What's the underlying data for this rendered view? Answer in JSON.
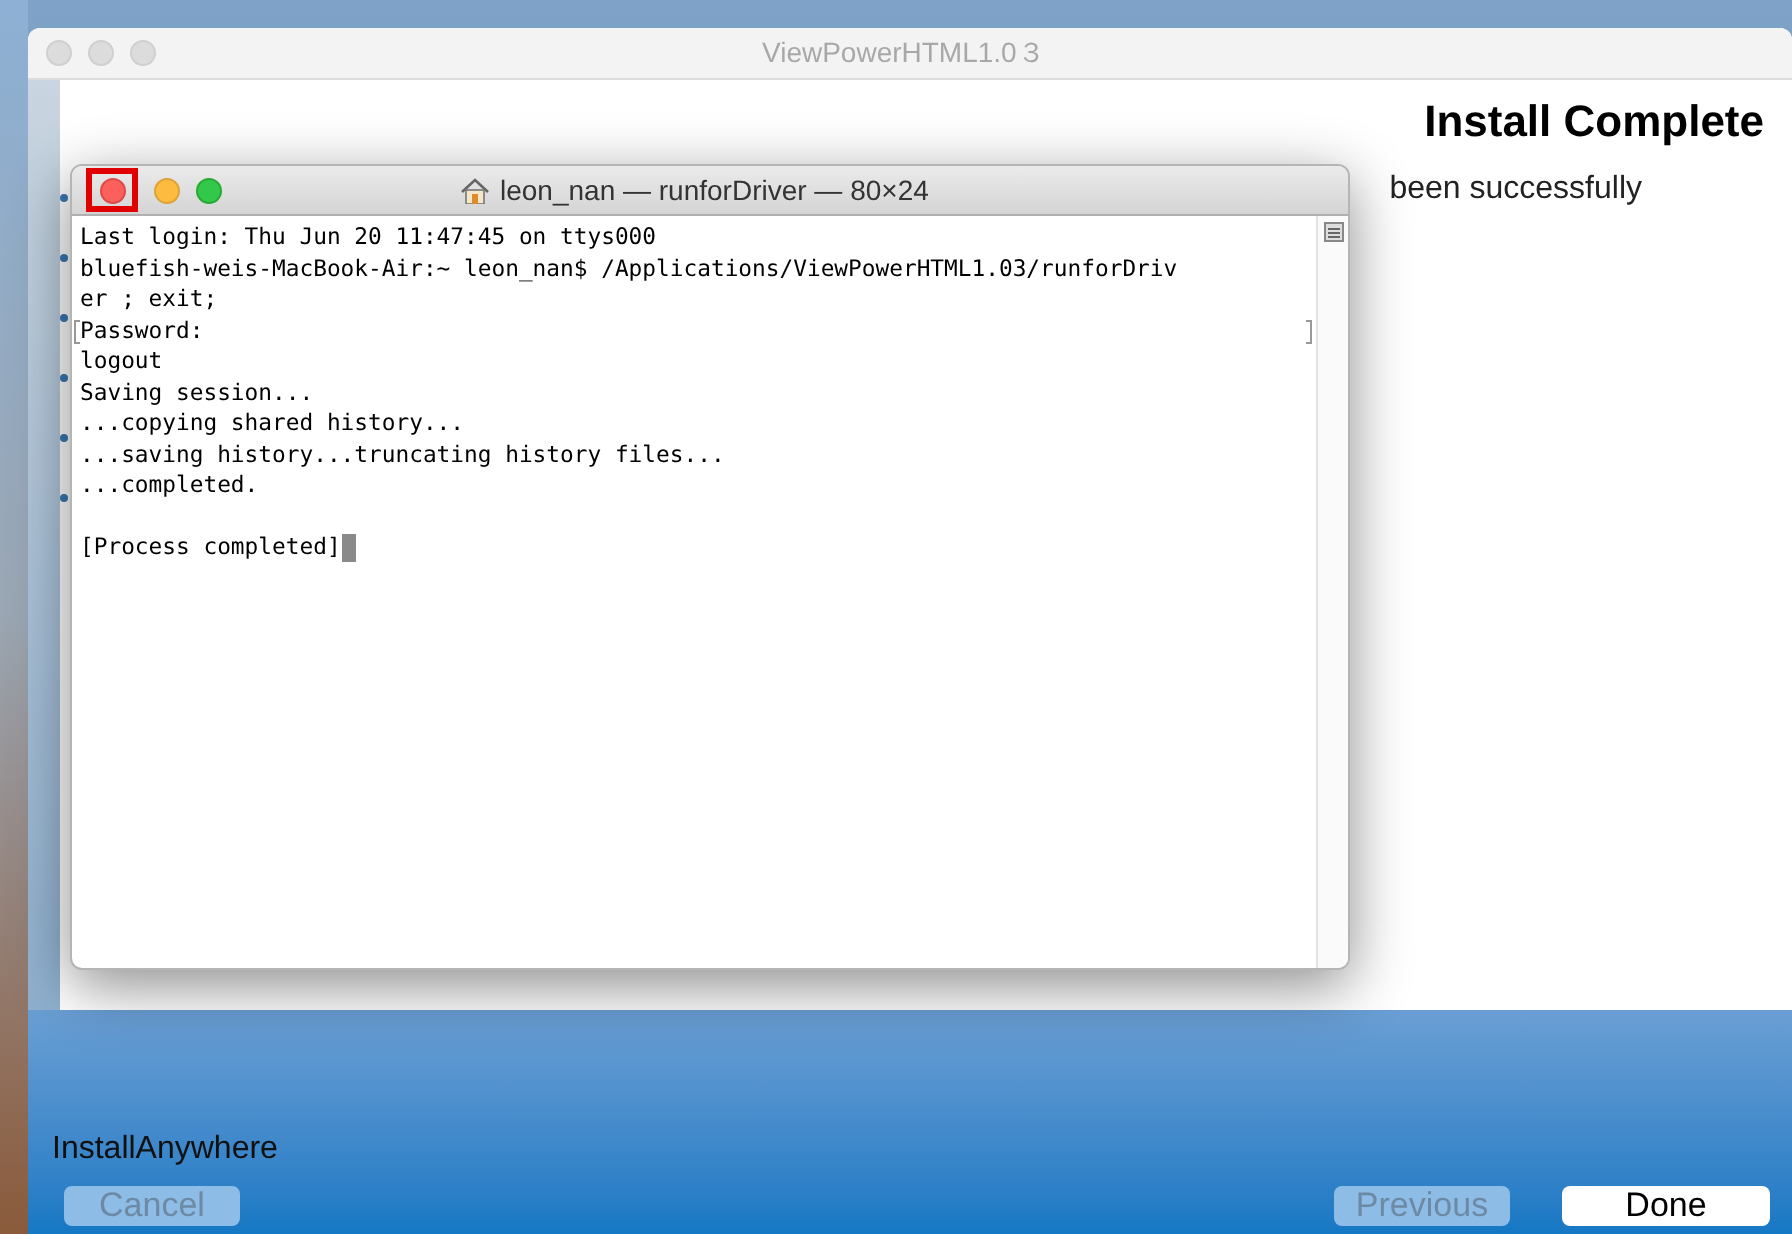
{
  "installer": {
    "title": "ViewPowerHTML1.0３",
    "heading": "Install Complete",
    "body_fragment": "been successfully",
    "brand": "InstallAnywhere",
    "buttons": [
      {
        "label": "Cancel",
        "disabled": true
      },
      {
        "label": "Previous",
        "disabled": true
      },
      {
        "label": "Done",
        "disabled": false
      }
    ]
  },
  "terminal": {
    "title": "leon_nan — runforDriver — 80×24",
    "close_highlighted": true,
    "lines": [
      {
        "text": "Last login: Thu Jun 20 11:47:45 on ttys000",
        "marked": false
      },
      {
        "text": "bluefish-weis-MacBook-Air:~ leon_nan$ /Applications/ViewPowerHTML1.03/runforDriv",
        "marked": false
      },
      {
        "text": "er ; exit;",
        "marked": false
      },
      {
        "text": "Password:",
        "marked": true
      },
      {
        "text": "logout",
        "marked": false
      },
      {
        "text": "Saving session...",
        "marked": false
      },
      {
        "text": "...copying shared history...",
        "marked": false
      },
      {
        "text": "...saving history...truncating history files...",
        "marked": false
      },
      {
        "text": "...completed.",
        "marked": false
      },
      {
        "marked": false
      },
      {
        "text": "[Process completed]",
        "marked": false
      }
    ]
  }
}
